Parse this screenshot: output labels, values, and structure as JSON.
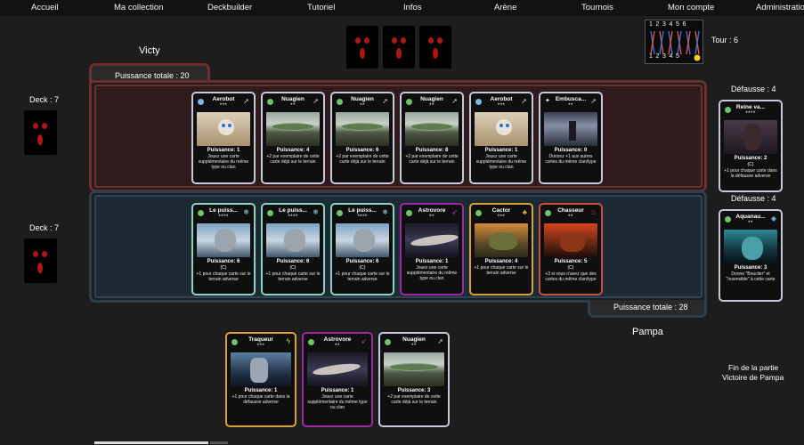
{
  "nav": [
    "Accueil",
    "Ma collection",
    "Deckbuilder",
    "Tutoriel",
    "Infos",
    "Arène",
    "Tournois",
    "Mon compte",
    "Administration"
  ],
  "opponent": {
    "name": "Victy",
    "deck": "Deck : 7",
    "total": "Puissance totale : 20",
    "discard": "Défausse : 4",
    "discard_card": {
      "name": "Reine va...",
      "stars": "****",
      "power": "Puissance: 2",
      "tag": "(C)",
      "desc": "+1 pour chaque carte dans la défausse adverse",
      "border": "#c5c9da",
      "icon_l": "",
      "icon_r": ""
    },
    "board": [
      {
        "name": "Aerobot",
        "stars": "***",
        "power": "Puissance: 1",
        "desc": "Jouez une carte supplémentaire du même type ou clan",
        "border": "#c5c9da",
        "art": "robot"
      },
      {
        "name": "Nuagien",
        "stars": "**",
        "power": "Puissance: 4",
        "desc": "+2 par exemplaire de cette carte déjà sur le terrain",
        "border": "#c5c9da",
        "art": "ufo"
      },
      {
        "name": "Nuagien",
        "stars": "**",
        "power": "Puissance: 6",
        "desc": "+2 par exemplaire de cette carte déjà sur le terrain",
        "border": "#c5c9da",
        "art": "ufo"
      },
      {
        "name": "Nuagien",
        "stars": "**",
        "power": "Puissance: 8",
        "desc": "+2 par exemplaire de cette carte déjà sur le terrain",
        "border": "#c5c9da",
        "art": "ufo"
      },
      {
        "name": "Aerobot",
        "stars": "***",
        "power": "Puissance: 1",
        "desc": "Jouez une carte supplémentaire du même type ou clan",
        "border": "#c5c9da",
        "art": "robot"
      },
      {
        "name": "Embusca...",
        "stars": "**",
        "power": "Puissance: 0",
        "desc": "Donnez +1 aux autres cartes du même clan/type",
        "border": "#c5c9da",
        "art": "storm"
      }
    ]
  },
  "player": {
    "name": "Pampa",
    "deck": "Deck : 7",
    "total": "Puissance totale : 28",
    "discard": "Défausse : 4",
    "discard_card": {
      "name": "Aquanau...",
      "stars": "**",
      "power": "Puissance: 3",
      "tag": "",
      "desc": "Donne \"Bouclier\" et \"Insensible\" à cette carte",
      "border": "#c5c9da",
      "art": "aqua"
    },
    "board": [
      {
        "name": "Le puiss...",
        "stars": "****",
        "power": "Puissance: 6",
        "tag": "(C)",
        "desc": "+1 pour chaque carte sur le terrain adverse",
        "border": "#8fd1c4",
        "art": "alien"
      },
      {
        "name": "Le puiss...",
        "stars": "****",
        "power": "Puissance: 6",
        "tag": "(C)",
        "desc": "+1 pour chaque carte sur le terrain adverse",
        "border": "#8fd1c4",
        "art": "alien"
      },
      {
        "name": "Le puiss...",
        "stars": "****",
        "power": "Puissance: 6",
        "tag": "(C)",
        "desc": "+1 pour chaque carte sur le terrain adverse",
        "border": "#8fd1c4",
        "art": "alien"
      },
      {
        "name": "Astrovore",
        "stars": "**",
        "power": "Puissance: 1",
        "desc": "Jouez une carte supplémentaire du même type ou clan",
        "border": "#a027a8",
        "art": "ship"
      },
      {
        "name": "Cactor",
        "stars": "***",
        "power": "Puissance: 4",
        "desc": "+1 pour chaque carte sur le terrain adverse",
        "border": "#d8a235",
        "art": "cactor"
      },
      {
        "name": "Chasseur",
        "stars": "**",
        "power": "Puissance: 5",
        "tag": "(C)",
        "desc": "+3 si vous n'avez que des cartes du même clan/type",
        "border": "#c9503e",
        "art": "fire"
      }
    ],
    "hand": [
      {
        "name": "Traqueur",
        "stars": "***",
        "power": "Puissance: 1",
        "desc": "+1 pour chaque carte dans la défausse adverse",
        "border": "#d8a235",
        "art": "mech"
      },
      {
        "name": "Astrovore",
        "stars": "**",
        "power": "Puissance: 1",
        "desc": "Jouez une carte supplémentaire du même type ou clan",
        "border": "#a027a8",
        "art": "ship"
      },
      {
        "name": "Nuagien",
        "stars": "**",
        "power": "Puissance: 3",
        "desc": "+2 par exemplaire de cette carte déjà sur le terrain",
        "border": "#c5c9da",
        "art": "ufo"
      }
    ]
  },
  "tour": "Tour : 6",
  "tracker": {
    "top": [
      "1",
      "2",
      "3",
      "4",
      "5",
      "6"
    ],
    "bottom": [
      "1",
      "2",
      "3",
      "4",
      "5"
    ]
  },
  "end": {
    "line1": "Fin de la partie",
    "line2": "Victoire de Pampa"
  }
}
